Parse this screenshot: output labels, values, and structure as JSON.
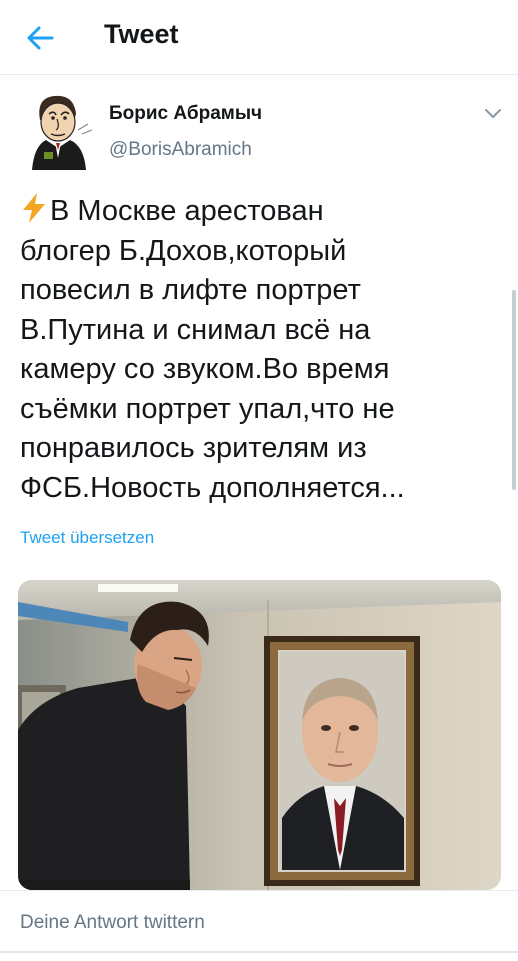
{
  "header": {
    "title": "Tweet"
  },
  "tweet": {
    "author_name": "Борис Абрамыч",
    "author_handle": "@BorisAbramich",
    "lines": [
      "В Москве арестован",
      "блогер Б.Дохов,который",
      "повесил в лифте портрет",
      "В.Путина и снимал всё на",
      "камеру со звуком.Во время",
      "съёмки портрет упал,что не",
      "понравилось зрителям из",
      "ФСБ.Новость дополняется..."
    ],
    "translate_label": "Tweet übersetzen"
  },
  "reply": {
    "placeholder": "Deine Antwort twittern"
  },
  "icons": {
    "back": "back-arrow-icon",
    "chevron": "chevron-down-icon",
    "bolt": "high-voltage-emoji"
  },
  "colors": {
    "accent": "#1da1f2",
    "bolt": "#f5a623",
    "secondary_text": "#657786"
  }
}
